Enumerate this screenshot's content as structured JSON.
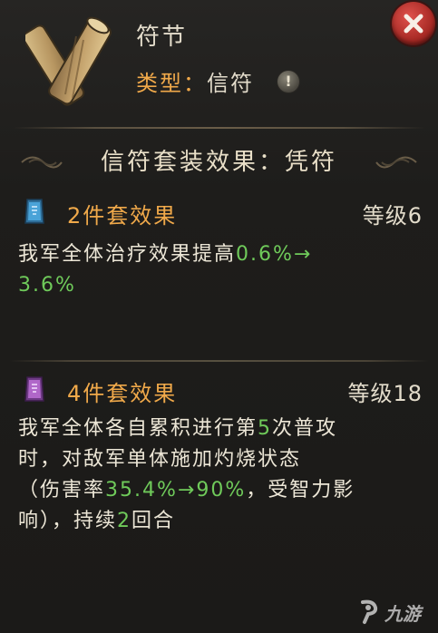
{
  "item": {
    "name": "符节",
    "type_label": "类型：",
    "type_value": "信符",
    "info_glyph": "!",
    "icon": "scroll-tally-icon"
  },
  "close_glyph": "✕",
  "set": {
    "title": "信符套装效果：凭符"
  },
  "bonuses": [
    {
      "title": "2件套效果",
      "level": "等级6",
      "gem_color": "#4aa3d8",
      "desc_parts": [
        "我军全体治疗效果提高",
        "0.6%→",
        "3.6%"
      ]
    },
    {
      "title": "4件套效果",
      "level": "等级18",
      "gem_color": "#b067c9",
      "desc_line1_a": "我军全体各自累积进行第",
      "desc_line1_num": "5",
      "desc_line1_b": "次普攻",
      "desc_line2": "时，对敌军单体施加灼烧状态",
      "desc_line3_a": "（伤害率",
      "desc_line3_num": "35.4%→90%",
      "desc_line3_b": "，受智力影",
      "desc_line4_a": "响），持续",
      "desc_line4_num": "2",
      "desc_line4_b": "回合"
    }
  ],
  "watermark": {
    "text": "九游",
    "icon": "jiuyou-logo-icon"
  },
  "colors": {
    "accent_orange": "#f0a94a",
    "value_green": "#6fca5a",
    "close_red": "#c33a33"
  }
}
